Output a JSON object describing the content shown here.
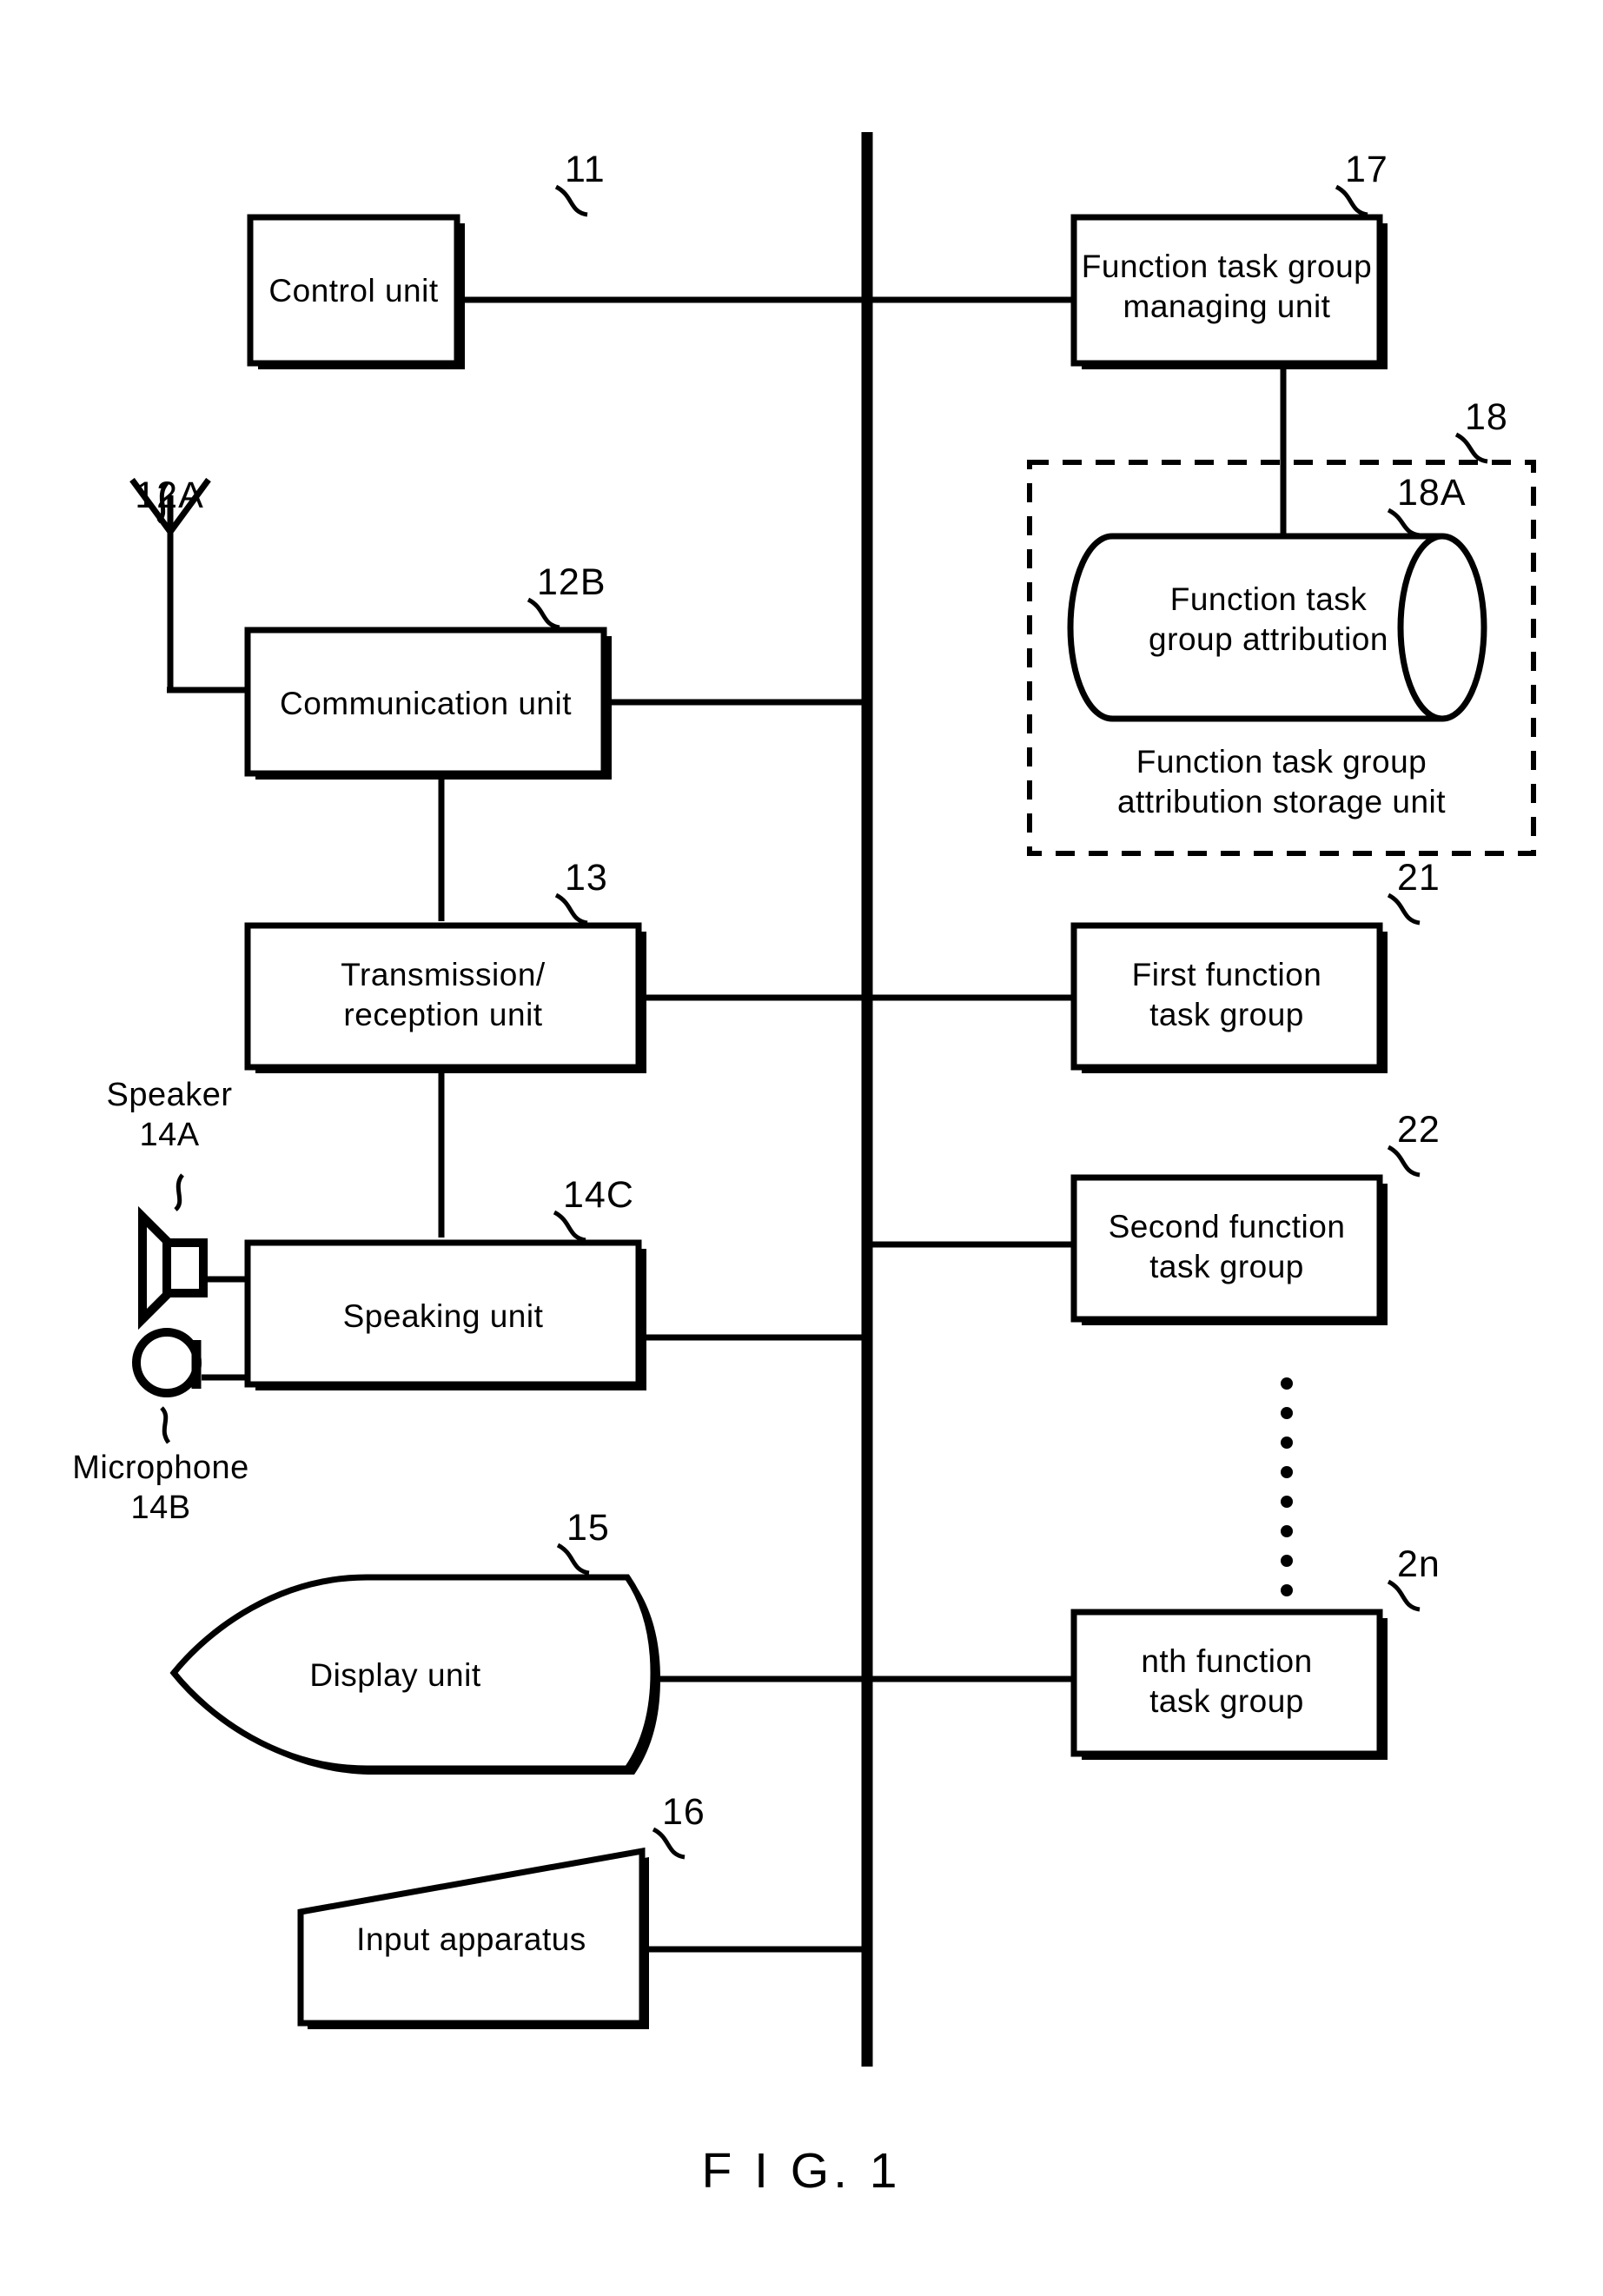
{
  "figure": {
    "caption": "F I G. 1",
    "type": "patent-block-diagram"
  },
  "bus": {
    "name": "system-bus",
    "orientation": "vertical"
  },
  "left_column": {
    "blocks": [
      {
        "id": "control-unit",
        "label": "Control unit",
        "ref": "11",
        "shape": "rectangle"
      },
      {
        "id": "communication-unit",
        "label": "Communication unit",
        "ref": "12B",
        "shape": "rectangle"
      },
      {
        "id": "transmission-reception-unit",
        "label_line1": "Transmission/",
        "label_line2": "reception unit",
        "ref": "13",
        "shape": "rectangle"
      },
      {
        "id": "speaking-unit",
        "label": "Speaking unit",
        "ref": "14C",
        "shape": "rectangle"
      },
      {
        "id": "display-unit",
        "label": "Display unit",
        "ref": "15",
        "shape": "crt-display"
      },
      {
        "id": "input-apparatus",
        "label": "Input apparatus",
        "ref": "16",
        "shape": "keyboard-trapezoid"
      }
    ],
    "peripherals": [
      {
        "id": "antenna",
        "ref": "12A",
        "shape": "antenna"
      },
      {
        "id": "speaker",
        "label": "Speaker",
        "ref": "14A",
        "shape": "horn"
      },
      {
        "id": "microphone",
        "label": "Microphone",
        "ref": "14B",
        "shape": "circle"
      }
    ]
  },
  "right_column": {
    "blocks": [
      {
        "id": "function-task-group-managing-unit",
        "label_line1": "Function task group",
        "label_line2": "managing unit",
        "ref": "17",
        "shape": "rectangle"
      },
      {
        "id": "first-function-task-group",
        "label_line1": "First function",
        "label_line2": "task group",
        "ref": "21",
        "shape": "rectangle"
      },
      {
        "id": "second-function-task-group",
        "label_line1": "Second function",
        "label_line2": "task group",
        "ref": "22",
        "shape": "rectangle"
      },
      {
        "id": "nth-function-task-group",
        "label_line1": "nth function",
        "label_line2": "task group",
        "ref": "2n",
        "shape": "rectangle"
      }
    ],
    "storage_group": {
      "id": "function-task-group-attribution-storage-unit",
      "ref": "18",
      "caption_line1": "Function task group",
      "caption_line2": "attribution storage unit",
      "database": {
        "id": "function-task-group-attribution",
        "label_line1": "Function task",
        "label_line2": "group attribution",
        "ref": "18A",
        "shape": "cylinder"
      }
    },
    "ellipsis": "vertical-dots"
  },
  "colors": {
    "line": "#000000",
    "background": "#ffffff"
  }
}
